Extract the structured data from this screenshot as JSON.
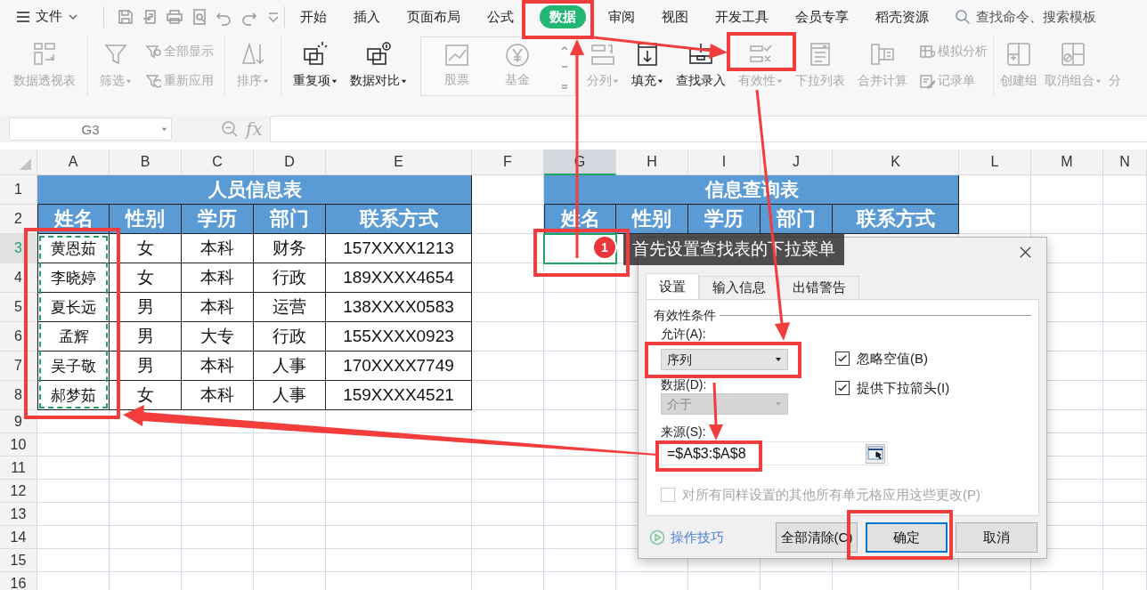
{
  "menu": {
    "file": "文件",
    "tabs": [
      {
        "label": "开始",
        "selected": false
      },
      {
        "label": "插入",
        "selected": false
      },
      {
        "label": "页面布局",
        "selected": false
      },
      {
        "label": "公式",
        "selected": false
      },
      {
        "label": "数据",
        "selected": true
      },
      {
        "label": "审阅",
        "selected": false
      },
      {
        "label": "视图",
        "selected": false
      },
      {
        "label": "开发工具",
        "selected": false
      },
      {
        "label": "会员专享",
        "selected": false
      },
      {
        "label": "稻壳资源",
        "selected": false
      }
    ],
    "search": {
      "placeholder": "查找命令、搜索模板"
    }
  },
  "ribbon": {
    "groups": [
      {
        "items": [
          {
            "kind": "large",
            "label": "数据透视表",
            "disabled": true,
            "dropdown": false
          }
        ]
      },
      {
        "items": [
          {
            "kind": "large",
            "label": "筛选",
            "disabled": true,
            "dropdown": true
          },
          {
            "kind": "pair",
            "items": [
              {
                "label": "全部显示",
                "disabled": true
              },
              {
                "label": "重新应用",
                "disabled": true
              }
            ]
          }
        ]
      },
      {
        "items": [
          {
            "kind": "large",
            "label": "排序",
            "disabled": true,
            "dropdown": true
          }
        ]
      },
      {
        "items": [
          {
            "kind": "large",
            "label": "重复项",
            "disabled": false,
            "dropdown": true
          },
          {
            "kind": "large",
            "label": "数据对比",
            "disabled": false,
            "dropdown": true
          },
          {
            "kind": "gallery",
            "items": [
              {
                "label": "股票",
                "disabled": true
              },
              {
                "label": "基金",
                "disabled": true
              }
            ]
          },
          {
            "kind": "large",
            "label": "分列",
            "disabled": true,
            "dropdown": true
          },
          {
            "kind": "large",
            "label": "填充",
            "disabled": false,
            "dropdown": true
          },
          {
            "kind": "large",
            "label": "查找录入",
            "disabled": false,
            "dropdown": false
          },
          {
            "kind": "large",
            "label": "有效性",
            "disabled": true,
            "dropdown": true
          },
          {
            "kind": "large",
            "label": "下拉列表",
            "disabled": true,
            "dropdown": false
          },
          {
            "kind": "large",
            "label": "合并计算",
            "disabled": true,
            "dropdown": false
          },
          {
            "kind": "pair",
            "items": [
              {
                "label": "模拟分析",
                "disabled": true
              },
              {
                "label": "记录单",
                "disabled": true
              }
            ]
          }
        ]
      },
      {
        "items": [
          {
            "kind": "large",
            "label": "创建组",
            "disabled": true,
            "dropdown": false
          },
          {
            "kind": "large",
            "label": "取消组合",
            "disabled": true,
            "dropdown": true
          },
          {
            "kind": "clipped",
            "label": "分",
            "disabled": true
          }
        ]
      }
    ]
  },
  "formula_bar": {
    "name_box": "G3",
    "fx": "fx"
  },
  "sheet": {
    "columns": [
      {
        "label": "A",
        "selected": false
      },
      {
        "label": "B",
        "selected": false
      },
      {
        "label": "C",
        "selected": false
      },
      {
        "label": "D",
        "selected": false
      },
      {
        "label": "E",
        "selected": false
      },
      {
        "label": "F",
        "selected": false
      },
      {
        "label": "G",
        "selected": true
      },
      {
        "label": "H",
        "selected": false
      },
      {
        "label": "I",
        "selected": false
      },
      {
        "label": "J",
        "selected": false
      },
      {
        "label": "K",
        "selected": false
      },
      {
        "label": "L",
        "selected": false
      },
      {
        "label": "M",
        "selected": false
      },
      {
        "label": "N",
        "selected": false
      }
    ],
    "rows": [
      {
        "label": "1",
        "selected": false
      },
      {
        "label": "2",
        "selected": false
      },
      {
        "label": "3",
        "selected": true
      },
      {
        "label": "4",
        "selected": false
      },
      {
        "label": "5",
        "selected": false
      },
      {
        "label": "6",
        "selected": false
      },
      {
        "label": "7",
        "selected": false
      },
      {
        "label": "8",
        "selected": false
      },
      {
        "label": "9",
        "selected": false
      },
      {
        "label": "10",
        "selected": false
      },
      {
        "label": "11",
        "selected": false
      },
      {
        "label": "12",
        "selected": false
      },
      {
        "label": "13",
        "selected": false
      },
      {
        "label": "14",
        "selected": false
      },
      {
        "label": "15",
        "selected": false
      },
      {
        "label": "16",
        "selected": false
      }
    ],
    "tables": [
      {
        "title": "人员信息表",
        "headers": [
          "姓名",
          "性别",
          "学历",
          "部门",
          "联系方式"
        ],
        "marquee_first_column": true,
        "rows": [
          [
            "黄恩茹",
            "女",
            "本科",
            "财务",
            "157XXXX1213"
          ],
          [
            "李晓婷",
            "女",
            "本科",
            "行政",
            "189XXXX4654"
          ],
          [
            "夏长远",
            "男",
            "本科",
            "运营",
            "138XXXX0583"
          ],
          [
            "孟辉",
            "男",
            "大专",
            "行政",
            "155XXXX0923"
          ],
          [
            "吴子敬",
            "男",
            "本科",
            "人事",
            "170XXXX7749"
          ],
          [
            "郝梦茹",
            "女",
            "本科",
            "人事",
            "159XXXX4521"
          ]
        ]
      },
      {
        "title": "信息查询表",
        "headers": [
          "姓名",
          "性别",
          "学历",
          "部门",
          "联系方式"
        ],
        "marquee_first_column": false
      }
    ]
  },
  "tooltip": {
    "step": "1",
    "text": "首先设置查找表的下拉菜单"
  },
  "dialog": {
    "tabs": [
      {
        "label": "设置",
        "selected": true
      },
      {
        "label": "输入信息",
        "selected": false
      },
      {
        "label": "出错警告",
        "selected": false
      }
    ],
    "section": "有效性条件",
    "allow": {
      "label": "允许(A):",
      "value": "序列"
    },
    "data": {
      "label": "数据(D):",
      "value": "介于",
      "disabled": true
    },
    "checkboxes": [
      {
        "label": "忽略空值(B)",
        "checked": true
      },
      {
        "label": "提供下拉箭头(I)",
        "checked": true
      }
    ],
    "source": {
      "label": "来源(S):",
      "value": "=$A$3:$A$8"
    },
    "apply_all": {
      "label": "对所有同样设置的其他所有单元格应用这些更改(P)",
      "checked": false,
      "disabled": true
    },
    "tips": "操作技巧",
    "buttons": [
      {
        "label": "全部清除(C)",
        "default": false
      },
      {
        "label": "确定",
        "default": true
      },
      {
        "label": "取消",
        "default": false
      }
    ]
  }
}
